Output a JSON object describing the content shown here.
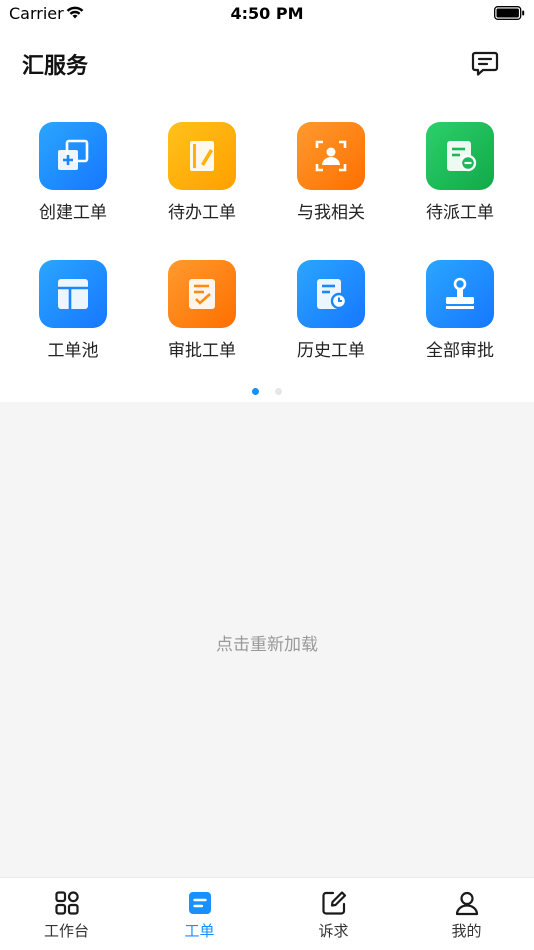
{
  "status_bar": {
    "carrier": "Carrier",
    "time": "4:50 PM"
  },
  "header": {
    "title": "汇服务",
    "message_icon": "message-icon"
  },
  "grid": {
    "items": [
      {
        "label": "创建工单",
        "icon": "create-order-icon",
        "colors": [
          "#2aa6ff",
          "#1677ff"
        ]
      },
      {
        "label": "待办工单",
        "icon": "todo-order-icon",
        "colors": [
          "#ffc21a",
          "#ff9f00"
        ]
      },
      {
        "label": "与我相关",
        "icon": "related-to-me-icon",
        "colors": [
          "#ff9a2e",
          "#ff6f00"
        ]
      },
      {
        "label": "待派工单",
        "icon": "pending-dispatch-icon",
        "colors": [
          "#2bd16a",
          "#12a84a"
        ]
      },
      {
        "label": "工单池",
        "icon": "order-pool-icon",
        "colors": [
          "#2aa6ff",
          "#1677ff"
        ]
      },
      {
        "label": "审批工单",
        "icon": "approval-order-icon",
        "colors": [
          "#ff9a2e",
          "#ff6f00"
        ]
      },
      {
        "label": "历史工单",
        "icon": "history-order-icon",
        "colors": [
          "#2aa6ff",
          "#1677ff"
        ]
      },
      {
        "label": "全部审批",
        "icon": "all-approval-icon",
        "colors": [
          "#2aa6ff",
          "#1677ff"
        ]
      }
    ]
  },
  "pager": {
    "active_page": 1,
    "page_count": 2,
    "active_color": "#1890ff"
  },
  "content": {
    "reload_text": "点击重新加载"
  },
  "tabbar": {
    "accent_color": "#1890ff",
    "tabs": [
      {
        "label": "工作台",
        "icon": "workbench-icon",
        "active": false
      },
      {
        "label": "工单",
        "icon": "work-order-icon",
        "active": true
      },
      {
        "label": "诉求",
        "icon": "appeal-icon",
        "active": false
      },
      {
        "label": "我的",
        "icon": "profile-icon",
        "active": false
      }
    ]
  }
}
